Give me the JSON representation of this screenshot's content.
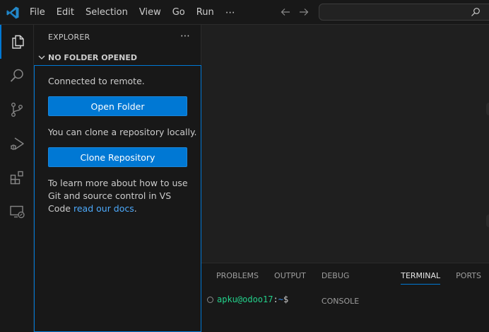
{
  "titlebar": {
    "menu": [
      "File",
      "Edit",
      "Selection",
      "View",
      "Go",
      "Run"
    ],
    "more": "⋯"
  },
  "sidebar": {
    "header": "EXPLORER",
    "more": "⋯",
    "section_title": "NO FOLDER OPENED",
    "welcome": {
      "connected": "Connected to remote.",
      "open_folder": "Open Folder",
      "clone_text": "You can clone a repository locally.",
      "clone_button": "Clone Repository",
      "learn_text": "To learn more about how to use Git and source control in VS Code",
      "docs_link": "read our docs",
      "period": "."
    }
  },
  "panel": {
    "tabs": [
      "PROBLEMS",
      "OUTPUT",
      "DEBUG CONSOLE",
      "TERMINAL",
      "PORTS"
    ],
    "active_tab": "TERMINAL",
    "terminal": {
      "user_host": "apku@odoo17",
      "colon": ":",
      "path": "~",
      "dollar": "$"
    }
  },
  "colors": {
    "accent": "#0078d4",
    "link": "#4daafc",
    "terminal_user": "#23d18b",
    "terminal_path": "#3b8eea"
  },
  "icons": {
    "activity": [
      "files-icon",
      "search-icon",
      "source-control-icon",
      "run-debug-icon",
      "extensions-icon",
      "remote-explorer-icon"
    ]
  }
}
